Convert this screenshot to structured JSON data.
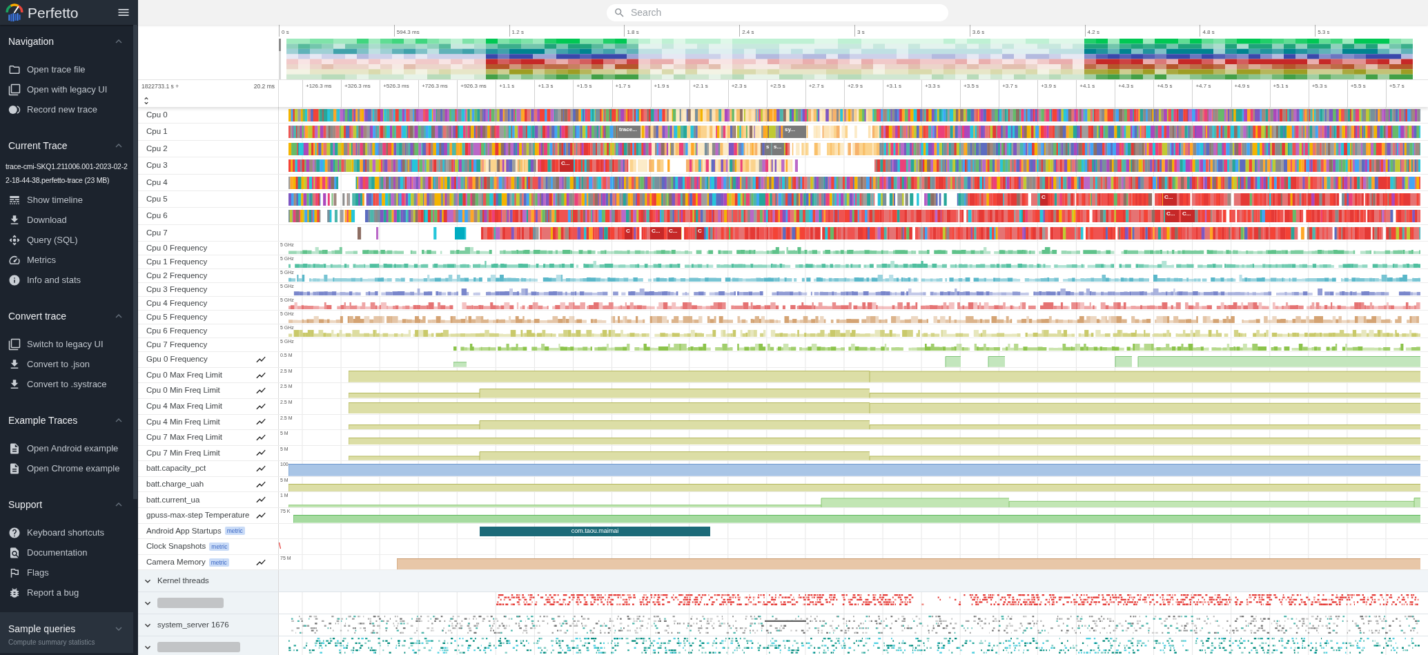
{
  "sidebar": {
    "title": "Perfetto",
    "sections": [
      {
        "title": "Navigation",
        "expanded": true,
        "items": [
          {
            "label": "Open trace file"
          },
          {
            "label": "Open with legacy UI"
          },
          {
            "label": "Record new trace"
          }
        ]
      },
      {
        "title": "Current Trace",
        "expanded": true,
        "trace_file": "trace-cmi-SKQ1.211006.001-2023-02-22-18-44-38.perfetto-trace (23 MB)",
        "items": [
          {
            "label": "Show timeline"
          },
          {
            "label": "Download"
          },
          {
            "label": "Query (SQL)"
          },
          {
            "label": "Metrics"
          },
          {
            "label": "Info and stats"
          }
        ]
      },
      {
        "title": "Convert trace",
        "expanded": true,
        "items": [
          {
            "label": "Switch to legacy UI"
          },
          {
            "label": "Convert to .json"
          },
          {
            "label": "Convert to .systrace"
          }
        ]
      },
      {
        "title": "Example Traces",
        "expanded": true,
        "items": [
          {
            "label": "Open Android example"
          },
          {
            "label": "Open Chrome example"
          }
        ]
      },
      {
        "title": "Support",
        "expanded": true,
        "items": [
          {
            "label": "Keyboard shortcuts"
          },
          {
            "label": "Documentation"
          },
          {
            "label": "Flags"
          },
          {
            "label": "Report a bug"
          }
        ]
      },
      {
        "title": "Sample queries",
        "expanded": false,
        "summary": "Compute summary statistics"
      }
    ]
  },
  "search": {
    "placeholder": "Search"
  },
  "overview": {
    "ticks": [
      "0 s",
      "594.3 ms",
      "1.2 s",
      "1.8 s",
      "2.4 s",
      "3 s",
      "3.6 s",
      "4.2 s",
      "4.8 s",
      "5.3 s"
    ]
  },
  "timeline": {
    "offset": "1822733.1 s +",
    "span": "20.2 ms",
    "ticks": [
      "+126.3 ms",
      "+326.3 ms",
      "+526.3 ms",
      "+726.3 ms",
      "+926.3 ms",
      "+1.1 s",
      "+1.3 s",
      "+1.5 s",
      "+1.7 s",
      "+1.9 s",
      "+2.1 s",
      "+2.3 s",
      "+2.5 s",
      "+2.7 s",
      "+2.9 s",
      "+3.1 s",
      "+3.3 s",
      "+3.5 s",
      "+3.7 s",
      "+3.9 s",
      "+4.1 s",
      "+4.3 s",
      "+4.5 s",
      "+4.7 s",
      "+4.9 s",
      "+5.1 s",
      "+5.3 s",
      "+5.5 s",
      "+5.7 s"
    ]
  },
  "tracks": [
    {
      "kind": "cpu",
      "label": "Cpu 0"
    },
    {
      "kind": "cpu",
      "label": "Cpu 1",
      "slices": [
        {
          "label": "trace..."
        },
        {
          "label": "sy..."
        }
      ]
    },
    {
      "kind": "cpu",
      "label": "Cpu 2",
      "slices": [
        {
          "label": "s"
        },
        {
          "label": "s..."
        }
      ]
    },
    {
      "kind": "cpu",
      "label": "Cpu 3",
      "slices": [
        {
          "label": "C..."
        }
      ]
    },
    {
      "kind": "cpu",
      "label": "Cpu 4"
    },
    {
      "kind": "cpu",
      "label": "Cpu 5",
      "slices": [
        {
          "label": "C"
        },
        {
          "label": "C..."
        }
      ]
    },
    {
      "kind": "cpu",
      "label": "Cpu 6",
      "slices": [
        {
          "label": "C..."
        },
        {
          "label": "C..."
        }
      ]
    },
    {
      "kind": "cpu",
      "label": "Cpu 7",
      "slices": [
        {
          "label": "C"
        },
        {
          "label": "C..."
        },
        {
          "label": "C..."
        },
        {
          "label": "C"
        }
      ]
    },
    {
      "kind": "frequency",
      "label": "Cpu 0 Frequency",
      "scale": "5 GHz"
    },
    {
      "kind": "frequency",
      "label": "Cpu 1 Frequency",
      "scale": "5 GHz"
    },
    {
      "kind": "frequency",
      "label": "Cpu 2 Frequency",
      "scale": "5 GHz"
    },
    {
      "kind": "frequency",
      "label": "Cpu 3 Frequency",
      "scale": "5 GHz"
    },
    {
      "kind": "frequency",
      "label": "Cpu 4 Frequency",
      "scale": "5 GHz"
    },
    {
      "kind": "frequency",
      "label": "Cpu 5 Frequency",
      "scale": "5 GHz"
    },
    {
      "kind": "frequency",
      "label": "Cpu 6 Frequency",
      "scale": "5 GHz"
    },
    {
      "kind": "frequency",
      "label": "Cpu 7 Frequency",
      "scale": "5 GHz"
    },
    {
      "kind": "counter",
      "label": "Gpu 0 Frequency",
      "scale": "0.5 M"
    },
    {
      "kind": "counter",
      "label": "Cpu 0 Max Freq Limit",
      "scale": "2.5 M"
    },
    {
      "kind": "counter",
      "label": "Cpu 0 Min Freq Limit",
      "scale": "2.5 M"
    },
    {
      "kind": "counter",
      "label": "Cpu 4 Max Freq Limit",
      "scale": "2.5 M"
    },
    {
      "kind": "counter",
      "label": "Cpu 4 Min Freq Limit",
      "scale": "2.5 M"
    },
    {
      "kind": "counter",
      "label": "Cpu 7 Max Freq Limit",
      "scale": "5 M"
    },
    {
      "kind": "counter",
      "label": "Cpu 7 Min Freq Limit",
      "scale": "5 M"
    },
    {
      "kind": "counter",
      "label": "batt.capacity_pct",
      "scale": "100"
    },
    {
      "kind": "counter",
      "label": "batt.charge_uah",
      "scale": "5 M"
    },
    {
      "kind": "counter",
      "label": "batt.current_ua",
      "scale": "1 M"
    },
    {
      "kind": "counter",
      "label": "gpuss-max-step Temperature",
      "scale": "75 K"
    },
    {
      "kind": "slices",
      "label": "Android App Startups",
      "tag": "metric",
      "slices": [
        {
          "label": "com.taou.maimai"
        }
      ]
    },
    {
      "kind": "snapshots",
      "label": "Clock Snapshots",
      "tag": "metric"
    },
    {
      "kind": "counter",
      "label": "Camera Memory",
      "tag": "metric",
      "scale": "75 M"
    }
  ],
  "track_groups": [
    {
      "kind": "named",
      "label": "Kernel threads",
      "expanded": false
    },
    {
      "kind": "redacted",
      "expanded": false
    },
    {
      "kind": "named",
      "label": "system_server 1676",
      "expanded": false
    },
    {
      "kind": "redacted",
      "expanded": false
    }
  ]
}
